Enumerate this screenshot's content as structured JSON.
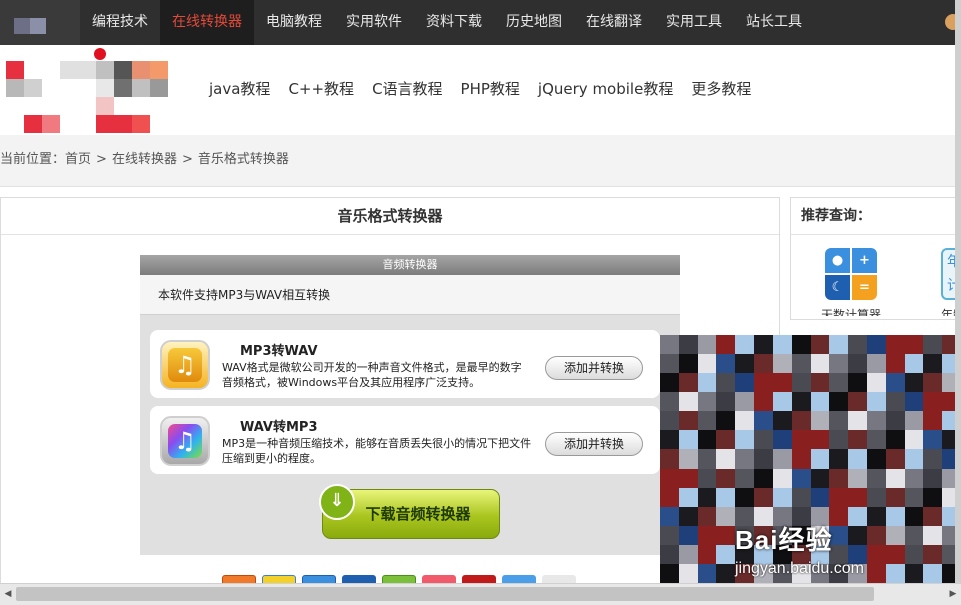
{
  "top_nav": {
    "items": [
      {
        "label": "编程技术"
      },
      {
        "label": "在线转换器"
      },
      {
        "label": "电脑教程"
      },
      {
        "label": "实用软件"
      },
      {
        "label": "资料下载"
      },
      {
        "label": "历史地图"
      },
      {
        "label": "在线翻译"
      },
      {
        "label": "实用工具"
      },
      {
        "label": "站长工具"
      }
    ],
    "active_index": 1,
    "active_color": "#e34a3a"
  },
  "sub_nav": {
    "items": [
      {
        "label": "java教程"
      },
      {
        "label": "C++教程"
      },
      {
        "label": "C语言教程"
      },
      {
        "label": "PHP教程"
      },
      {
        "label": "jQuery mobile教程"
      },
      {
        "label": "更多教程"
      }
    ]
  },
  "breadcrumb": {
    "prefix": "当前位置：",
    "items": [
      "首页",
      "在线转换器",
      "音乐格式转换器"
    ],
    "separator": ">"
  },
  "main": {
    "title": "音乐格式转换器",
    "converter": {
      "header": "音频转换器",
      "description": "本软件支持MP3与WAV相互转换",
      "cards": [
        {
          "title": "MP3转WAV",
          "text": "WAV格式是微软公司开发的一种声音文件格式，是最早的数字音频格式，被Windows平台及其应用程序广泛支持。",
          "button": "添加并转换",
          "icon": "music-note-icon"
        },
        {
          "title": "WAV转MP3",
          "text": "MP3是一种音频压缩技术，能够在音质丢失很小的情况下把文件压缩到更小的程度。",
          "button": "添加并转换",
          "icon": "music-note-icon"
        }
      ],
      "download_button": "下载音频转换器"
    }
  },
  "sidebar": {
    "title": "推荐查询：",
    "tools": [
      {
        "label": "天数计算器",
        "icon": "calculator-icon"
      },
      {
        "label": "年龄",
        "icon": "calendar-icon"
      }
    ]
  },
  "watermark": {
    "brand": "Bai经验",
    "url": "jingyan.baidu.com"
  },
  "colors": {
    "topbar": "#2f2f2f",
    "download_green": "#a9c51f"
  }
}
